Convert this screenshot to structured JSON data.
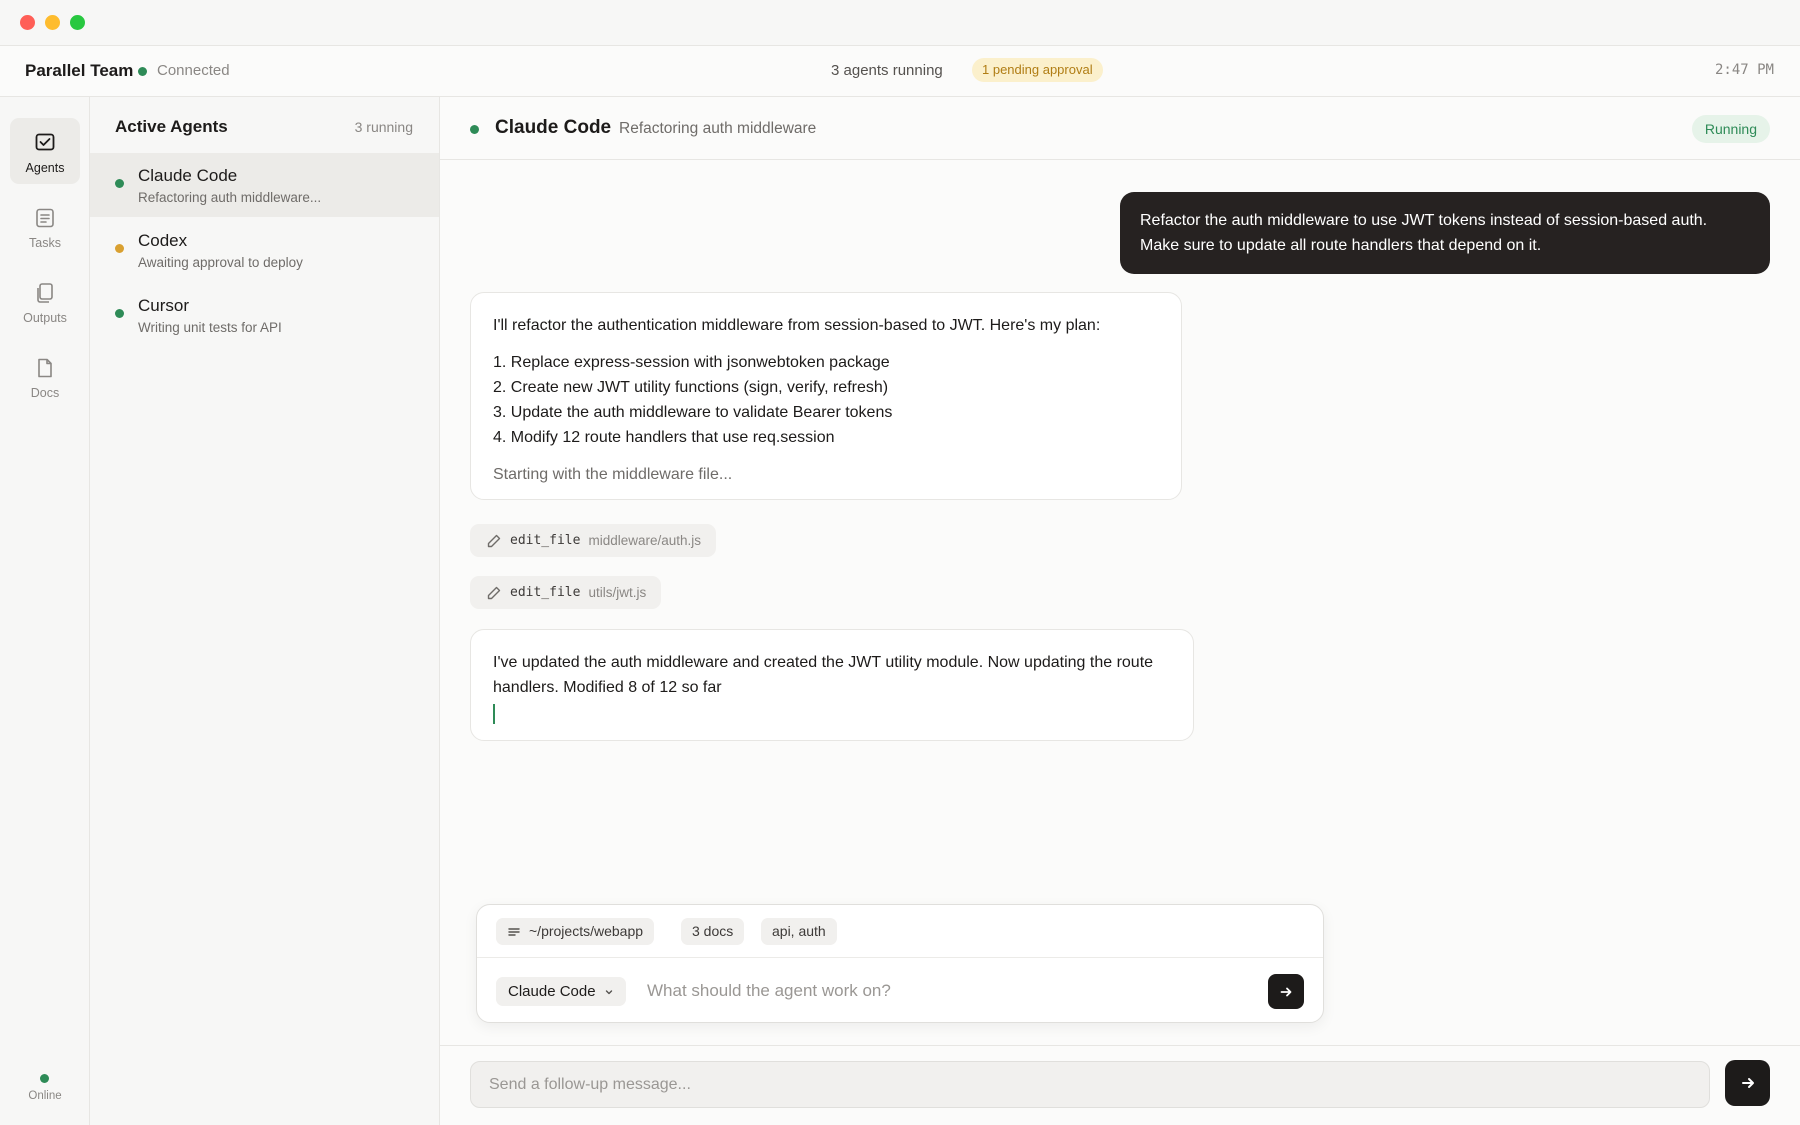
{
  "header": {
    "team_name": "Parallel Team",
    "connection_status": "Connected",
    "agents_running": "3 agents running",
    "pending_badge": "1 pending approval",
    "time": "2:47 PM"
  },
  "rail": {
    "items": [
      {
        "label": "Agents",
        "icon": "check-square-icon",
        "active": true
      },
      {
        "label": "Tasks",
        "icon": "tasks-list-icon",
        "active": false
      },
      {
        "label": "Outputs",
        "icon": "copy-stack-icon",
        "active": false
      },
      {
        "label": "Docs",
        "icon": "document-icon",
        "active": false
      }
    ],
    "status_label": "Online"
  },
  "agent_list": {
    "title": "Active Agents",
    "count": "3 running",
    "agents": [
      {
        "name": "Claude Code",
        "task": "Refactoring auth middleware...",
        "status_color": "#2e8b57",
        "selected": true
      },
      {
        "name": "Codex",
        "task": "Awaiting approval to deploy",
        "status_color": "#d9a030",
        "selected": false
      },
      {
        "name": "Cursor",
        "task": "Writing unit tests for API",
        "status_color": "#2e8b57",
        "selected": false
      }
    ]
  },
  "conversation": {
    "agent_name": "Claude Code",
    "agent_task": "Refactoring auth middleware",
    "status": "Running",
    "user_message": "Refactor the auth middleware to use JWT tokens instead of session-based auth. Make sure to update all route handlers that depend on it.",
    "agent_message_1": {
      "intro": "I'll refactor the authentication middleware from session-based to JWT. Here's my plan:",
      "steps": [
        "1. Replace express-session with jsonwebtoken package",
        "2. Create new JWT utility functions (sign, verify, refresh)",
        "3. Update the auth middleware to validate Bearer tokens",
        "4. Modify 12 route handlers that use req.session"
      ],
      "trailing": "Starting with the middleware file..."
    },
    "tool_calls": [
      {
        "tool": "edit_file",
        "path": "middleware/auth.js"
      },
      {
        "tool": "edit_file",
        "path": "utils/jwt.js"
      }
    ],
    "agent_message_2": "I've updated the auth middleware and created the JWT utility module. Now updating the route handlers. Modified 8 of 12 so far"
  },
  "composer": {
    "context_chips": [
      "~/projects/webapp",
      "3 docs",
      "api, auth"
    ],
    "selected_agent": "Claude Code",
    "placeholder": "What should the agent work on?"
  },
  "followup": {
    "placeholder": "Send a follow-up message..."
  },
  "colors": {
    "accent_dark": "#1d1b1a",
    "running_green": "#2e8b57",
    "pending_amber": "#d9a030"
  }
}
